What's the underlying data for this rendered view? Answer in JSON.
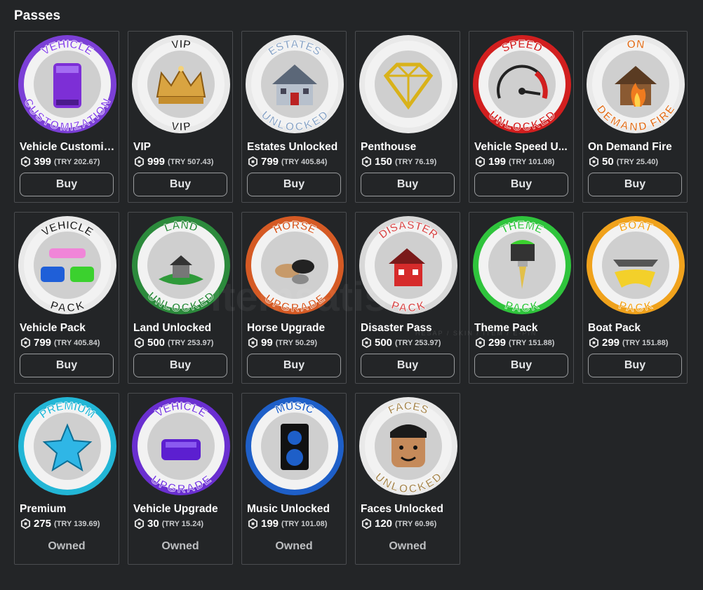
{
  "section_title": "Passes",
  "currency_icon": "robux-icon",
  "watermark": {
    "text": "itemsatis",
    "sub": "HESAP / SKIN / ITEM / E-PIN",
    "suffix": ".com"
  },
  "passes": [
    {
      "name": "Vehicle Customiz...",
      "price": "399",
      "try": "(TRY 202.67)",
      "action": "Buy",
      "ring": "#7b3fd6",
      "top": "VEHICLE",
      "bottom": "CUSTOMIZATION",
      "topColor": "#8a4be8",
      "bottomColor": "#8a4be8",
      "art": "limo-icon"
    },
    {
      "name": "VIP",
      "price": "999",
      "try": "(TRY 507.43)",
      "action": "Buy",
      "ring": "#e9e9e9",
      "top": "VIP",
      "bottom": "VIP",
      "topColor": "#222222",
      "bottomColor": "#222222",
      "art": "crown-icon"
    },
    {
      "name": "Estates Unlocked",
      "price": "799",
      "try": "(TRY 405.84)",
      "action": "Buy",
      "ring": "#e9e9e9",
      "top": "ESTATES",
      "bottom": "UNLOCKED",
      "topColor": "#8ea7c7",
      "bottomColor": "#8ea7c7",
      "art": "mansion-icon"
    },
    {
      "name": "Penthouse",
      "price": "150",
      "try": "(TRY 76.19)",
      "action": "Buy",
      "ring": "#e9e9e9",
      "top": "",
      "bottom": "",
      "topColor": "#c9a21a",
      "bottomColor": "#c9a21a",
      "art": "diamond-icon"
    },
    {
      "name": "Vehicle Speed U...",
      "price": "199",
      "try": "(TRY 101.08)",
      "action": "Buy",
      "ring": "#d21f1f",
      "top": "SPEED",
      "bottom": "UNLOCKED",
      "topColor": "#d21f1f",
      "bottomColor": "#d21f1f",
      "art": "speedometer-icon"
    },
    {
      "name": "On Demand Fire",
      "price": "50",
      "try": "(TRY 25.40)",
      "action": "Buy",
      "ring": "#e9e9e9",
      "top": "ON",
      "bottom": "DEMAND FIRE",
      "topColor": "#e0701f",
      "bottomColor": "#e0701f",
      "art": "burning-house-icon"
    },
    {
      "name": "Vehicle Pack",
      "price": "799",
      "try": "(TRY 405.84)",
      "action": "Buy",
      "ring": "#e9e9e9",
      "top": "VEHICLE",
      "bottom": "PACK",
      "topColor": "#222222",
      "bottomColor": "#222222",
      "art": "cars-icon"
    },
    {
      "name": "Land Unlocked",
      "price": "500",
      "try": "(TRY 253.97)",
      "action": "Buy",
      "ring": "#2c8a3c",
      "top": "LAND",
      "bottom": "UNLOCKED",
      "topColor": "#2c8a3c",
      "bottomColor": "#2c8a3c",
      "art": "island-house-icon"
    },
    {
      "name": "Horse Upgrade",
      "price": "99",
      "try": "(TRY 50.29)",
      "action": "Buy",
      "ring": "#d55a24",
      "top": "HORSE",
      "bottom": "UPGRADE",
      "topColor": "#d55a24",
      "bottomColor": "#d55a24",
      "art": "horses-icon"
    },
    {
      "name": "Disaster Pass",
      "price": "500",
      "try": "(TRY 253.97)",
      "action": "Buy",
      "ring": "#d8d8d8",
      "top": "DISASTER",
      "bottom": "PACK",
      "topColor": "#d64a4a",
      "bottomColor": "#d64a4a",
      "art": "broken-house-icon"
    },
    {
      "name": "Theme Pack",
      "price": "299",
      "try": "(TRY 151.88)",
      "action": "Buy",
      "ring": "#2fc43c",
      "top": "THEME",
      "bottom": "PACK",
      "topColor": "#2fc43c",
      "bottomColor": "#2fc43c",
      "art": "paintbrush-icon"
    },
    {
      "name": "Boat Pack",
      "price": "299",
      "try": "(TRY 151.88)",
      "action": "Buy",
      "ring": "#f0a21c",
      "top": "BOAT",
      "bottom": "PACK",
      "topColor": "#f0a21c",
      "bottomColor": "#f0a21c",
      "art": "boats-icon"
    },
    {
      "name": "Premium",
      "price": "275",
      "try": "(TRY 139.69)",
      "action": "Owned",
      "ring": "#22b6d6",
      "top": "PREMIUM",
      "bottom": "",
      "topColor": "#22b6d6",
      "bottomColor": "#22b6d6",
      "art": "star-icon"
    },
    {
      "name": "Vehicle Upgrade",
      "price": "30",
      "try": "(TRY 15.24)",
      "action": "Owned",
      "ring": "#6a2fd0",
      "top": "VEHICLE",
      "bottom": "UPGRADE",
      "topColor": "#7a3fe0",
      "bottomColor": "#7a3fe0",
      "art": "car-upgrade-icon"
    },
    {
      "name": "Music Unlocked",
      "price": "199",
      "try": "(TRY 101.08)",
      "action": "Owned",
      "ring": "#1e5fc8",
      "top": "MUSIC",
      "bottom": "",
      "topColor": "#1e5fc8",
      "bottomColor": "#1e5fc8",
      "art": "speaker-icon"
    },
    {
      "name": "Faces Unlocked",
      "price": "120",
      "try": "(TRY 60.96)",
      "action": "Owned",
      "ring": "#e9e9e9",
      "top": "FACES",
      "bottom": "UNLOCKED",
      "topColor": "#a88a55",
      "bottomColor": "#a88a55",
      "art": "face-icon"
    }
  ]
}
